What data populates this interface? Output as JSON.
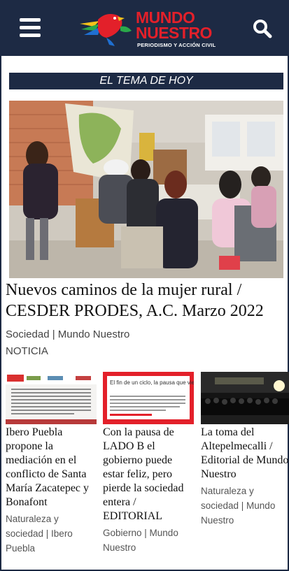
{
  "header": {
    "logo_line1": "MUNDO",
    "logo_line2": "NUESTRO",
    "logo_tagline": "PERIODISMO Y ACCIÓN CIVIL",
    "menu_icon": "hamburger-menu-icon",
    "search_icon": "search-icon",
    "bg_color": "#1d2a44",
    "brand_color": "#e3202a"
  },
  "topic": {
    "label": "EL TEMA DE HOY"
  },
  "featured": {
    "title": "Nuevos caminos de la mujer rural / CESDER PRODES, A.C. Marzo 2022",
    "meta": "Sociedad | Mundo Nuestro",
    "tag": "NOTICIA"
  },
  "articles": [
    {
      "title": "Ibero Puebla propone la mediación en el conflicto de Santa María Zacatepec y Bonafont",
      "meta": "Naturaleza y sociedad | Ibero Puebla"
    },
    {
      "title": "Con la pausa de LADO B el gobierno puede estar feliz, pero pierde la sociedad entera / EDITORIAL",
      "meta": "Gobierno | Mundo Nuestro",
      "thumb_text_a": "El fin de un ciclo, la pausa que viene para LADO B"
    },
    {
      "title": "La toma del Altepelmecalli / Editorial de Mundo Nuestro",
      "meta": "Naturaleza y sociedad | Mundo Nuestro"
    }
  ]
}
